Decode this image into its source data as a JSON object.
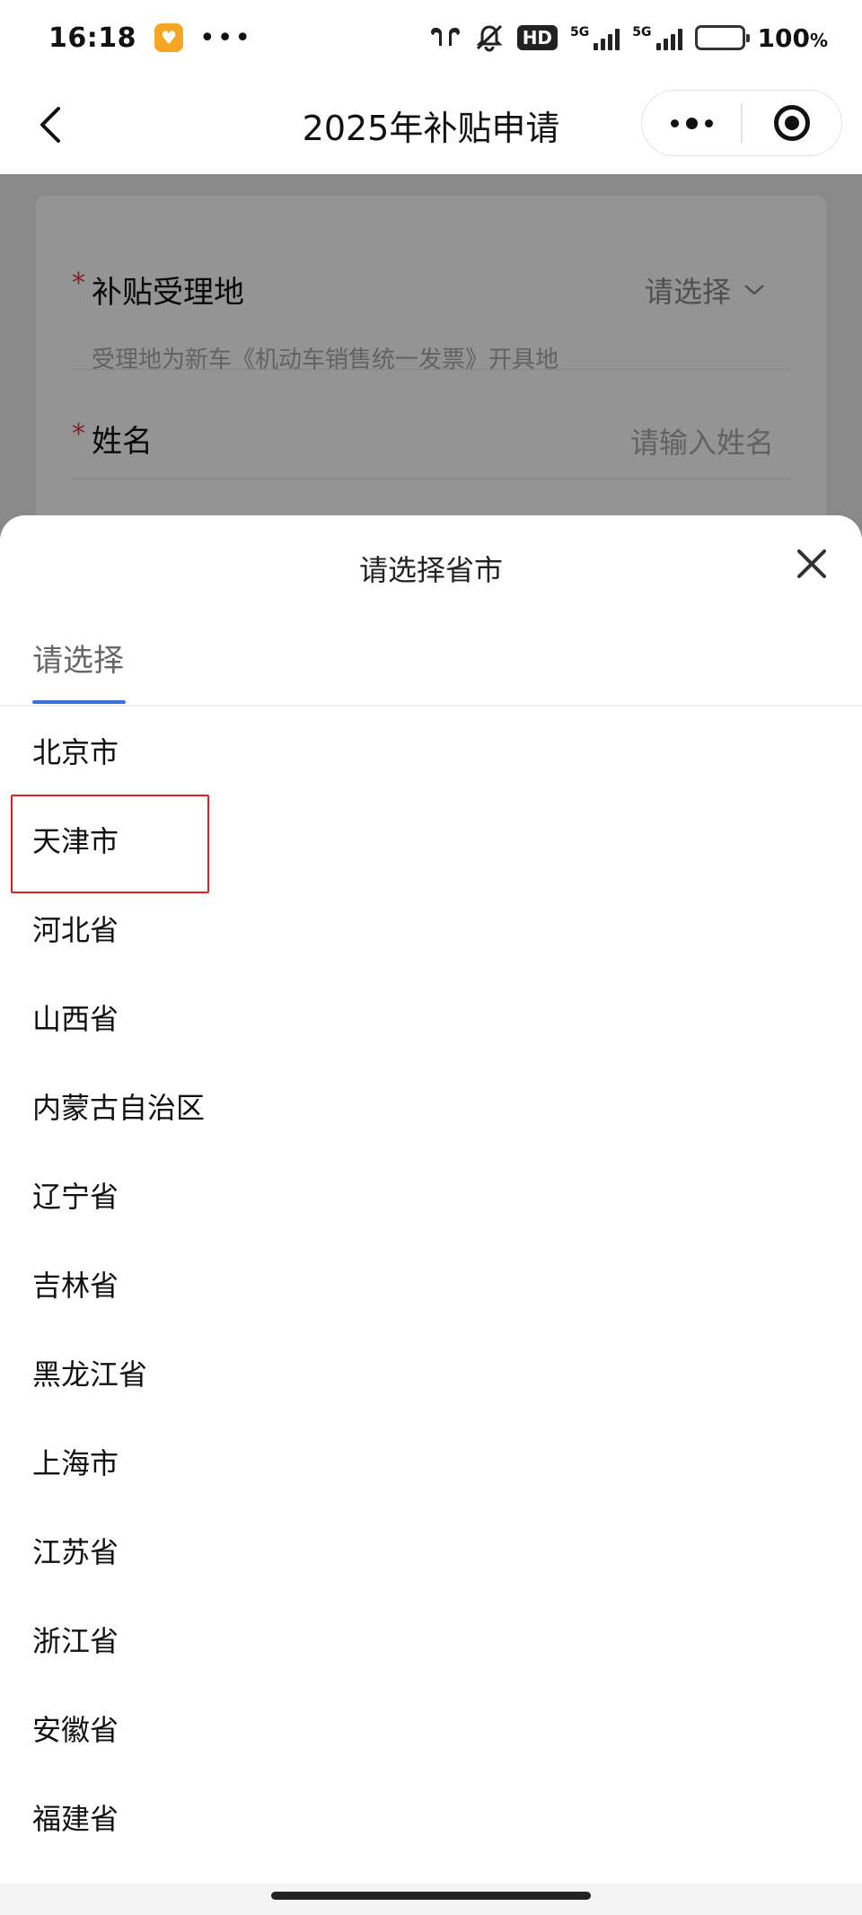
{
  "status_bar": {
    "time": "16:18",
    "app_badge_icon": "notification-app-icon",
    "dots": "•••",
    "hd_label": "HD",
    "network_1": "5G",
    "network_2": "5G",
    "battery_percent": "100",
    "battery_unit": "%"
  },
  "header": {
    "title": "2025年补贴申请"
  },
  "form": {
    "field1_label": "补贴受理地",
    "field1_value": "请选择",
    "field1_hint": "受理地为新车《机动车销售统一发票》开具地",
    "field2_label": "姓名",
    "field2_placeholder": "请输入姓名",
    "required_mark": "*"
  },
  "sheet": {
    "title": "请选择省市",
    "active_tab": "请选择",
    "accent_color": "#3a6fe0",
    "highlight_color": "#e02020",
    "items": [
      "北京市",
      "天津市",
      "河北省",
      "山西省",
      "内蒙古自治区",
      "辽宁省",
      "吉林省",
      "黑龙江省",
      "上海市",
      "江苏省",
      "浙江省",
      "安徽省",
      "福建省"
    ]
  }
}
